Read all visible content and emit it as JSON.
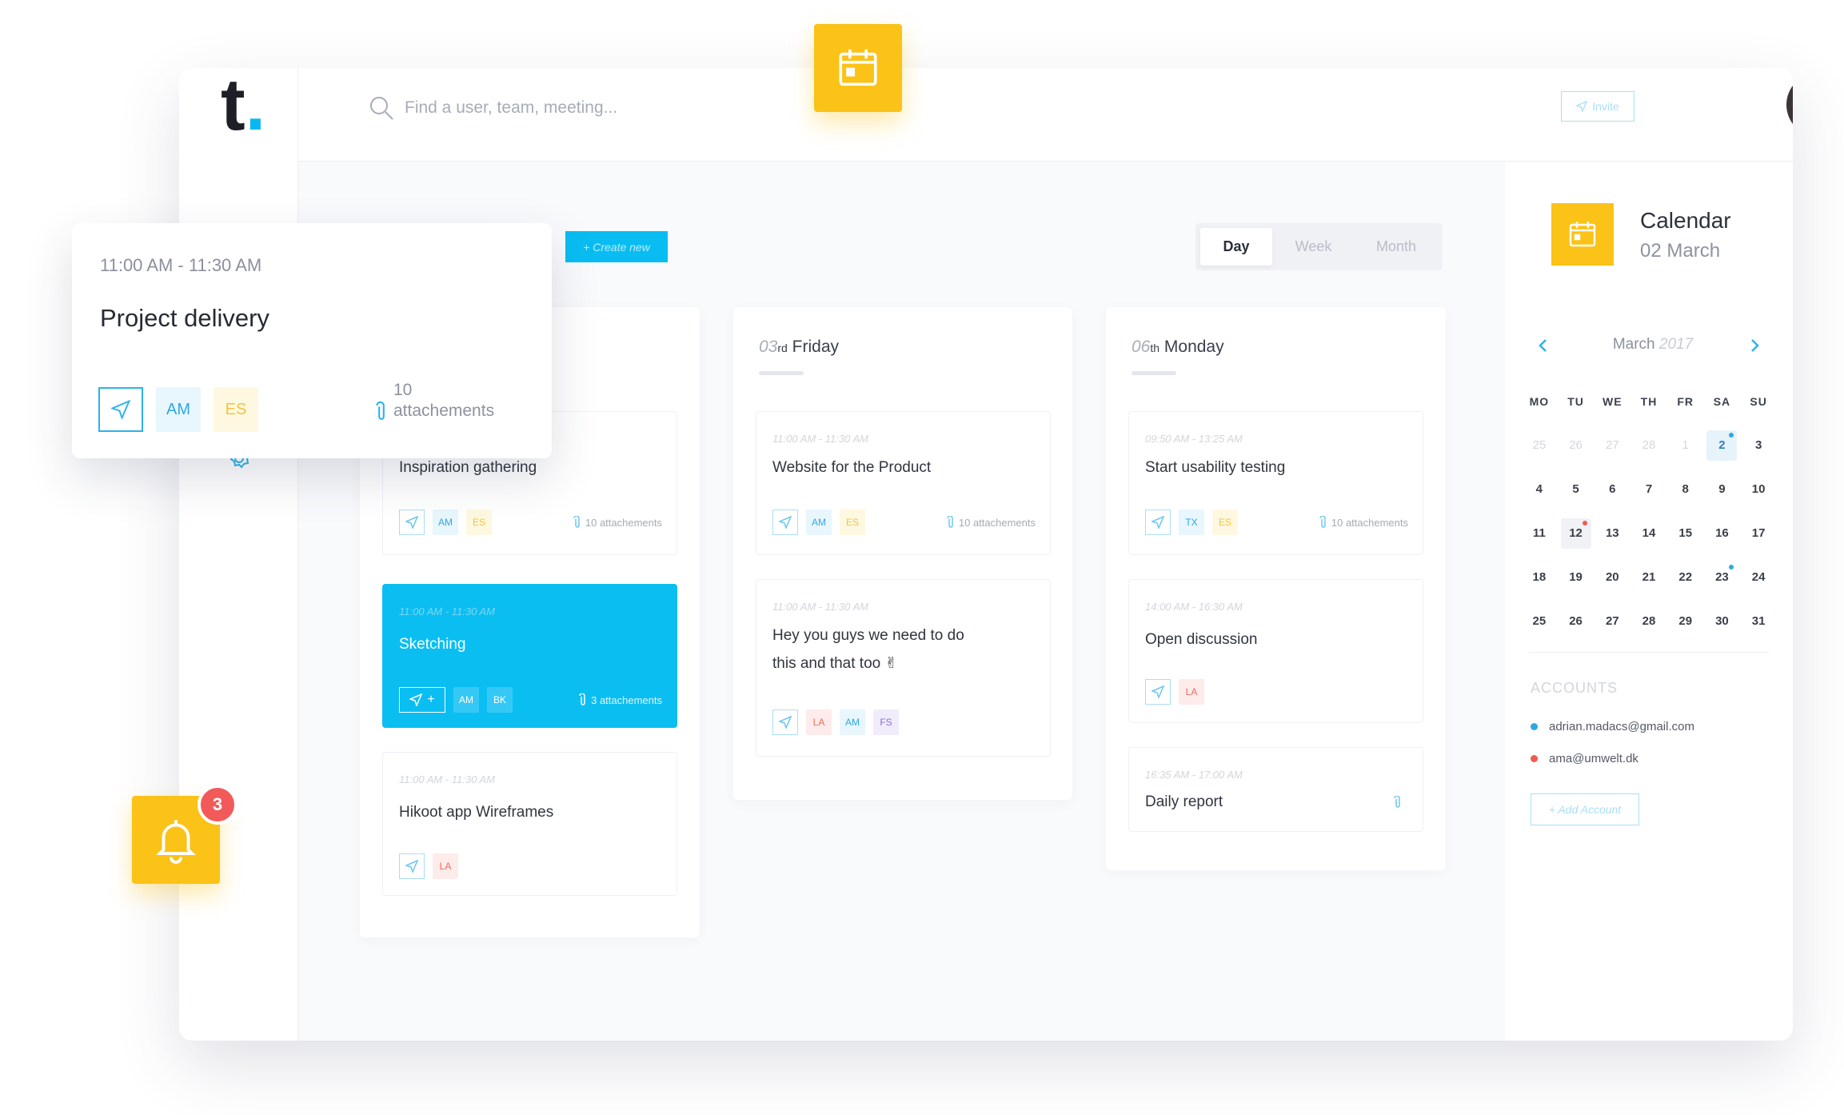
{
  "app": {
    "logo_letter": "t",
    "logo_dot": ".",
    "accent_color": "#09bdf2",
    "yellow_color": "#fbc217"
  },
  "search": {
    "placeholder": "Find a user, team, meeting..."
  },
  "header": {
    "invite_label": "Invite"
  },
  "toolbar": {
    "create_new_label": "+ Create new",
    "view_tabs": [
      {
        "label": "Day",
        "active": true
      },
      {
        "label": "Week",
        "active": false
      },
      {
        "label": "Month",
        "active": false
      }
    ]
  },
  "columns": [
    {
      "cards": [
        {
          "title": "Inspiration gathering",
          "people": [
            "AM",
            "ES"
          ],
          "attachments": "10 attachements"
        },
        {
          "time": "11:00 AM - 11:30 AM",
          "title": "Sketching",
          "people": [
            "AM",
            "BK"
          ],
          "attachments": "3 attachements",
          "send_extra": "+",
          "active": true
        },
        {
          "time": "11:00 AM - 11:30 AM",
          "title": "Hikoot app Wireframes",
          "people": [
            "LA"
          ]
        }
      ]
    },
    {
      "day_num": "03",
      "day_suffix": "rd",
      "day_name": "Friday",
      "cards": [
        {
          "time": "11:00 AM - 11:30 AM",
          "title": "Website for the Product",
          "people": [
            "AM",
            "ES"
          ],
          "attachments": "10 attachements"
        },
        {
          "time": "11:00 AM - 11:30 AM",
          "title_line1": "Hey you guys we need to do",
          "title_line2": "this and that too ✌",
          "people": [
            "LA",
            "AM",
            "FS"
          ]
        }
      ]
    },
    {
      "day_num": "06",
      "day_suffix": "th",
      "day_name": "Monday",
      "cards": [
        {
          "time": "09:50 AM - 13:25 AM",
          "title": "Start usability testing",
          "people": [
            "TX",
            "ES"
          ],
          "attachments": "10 attachements"
        },
        {
          "time": "14:00 AM - 16:30 AM",
          "title": "Open discussion",
          "people": [
            "LA"
          ]
        },
        {
          "time": "16:35 AM - 17:00 AM",
          "title": "Daily report"
        }
      ]
    }
  ],
  "calendar": {
    "title": "Calendar",
    "date": "02 March",
    "month": "March",
    "year": "2017",
    "weekdays": [
      "MO",
      "TU",
      "WE",
      "TH",
      "FR",
      "SA",
      "SU"
    ],
    "days": [
      {
        "n": "25",
        "muted": true
      },
      {
        "n": "26",
        "muted": true
      },
      {
        "n": "27",
        "muted": true
      },
      {
        "n": "28",
        "muted": true
      },
      {
        "n": "1",
        "muted": true
      },
      {
        "n": "2",
        "selected": true,
        "dot": "#2fa8e0"
      },
      {
        "n": "3"
      },
      {
        "n": "4"
      },
      {
        "n": "5"
      },
      {
        "n": "6"
      },
      {
        "n": "7"
      },
      {
        "n": "8"
      },
      {
        "n": "9"
      },
      {
        "n": "10"
      },
      {
        "n": "11"
      },
      {
        "n": "12",
        "today": true,
        "dot": "#f05a4a"
      },
      {
        "n": "13"
      },
      {
        "n": "14"
      },
      {
        "n": "15"
      },
      {
        "n": "16"
      },
      {
        "n": "17"
      },
      {
        "n": "18"
      },
      {
        "n": "19"
      },
      {
        "n": "20"
      },
      {
        "n": "21"
      },
      {
        "n": "22"
      },
      {
        "n": "23",
        "dot": "#2fa8e0"
      },
      {
        "n": "24"
      },
      {
        "n": "25"
      },
      {
        "n": "26"
      },
      {
        "n": "27"
      },
      {
        "n": "28"
      },
      {
        "n": "29"
      },
      {
        "n": "30"
      },
      {
        "n": "31"
      }
    ]
  },
  "accounts": {
    "label": "ACCOUNTS",
    "items": [
      {
        "email": "adrian.madacs@gmail.com",
        "color": "#2fa8e0"
      },
      {
        "email": "ama@umwelt.dk",
        "color": "#f05a4a"
      }
    ],
    "add_label": "+ Add Account"
  },
  "popup": {
    "time": "11:00 AM - 11:30 AM",
    "title": "Project delivery",
    "people": [
      "AM",
      "ES"
    ],
    "attach_count": "10",
    "attach_word": "attachements"
  },
  "notifications": {
    "count": "3"
  }
}
